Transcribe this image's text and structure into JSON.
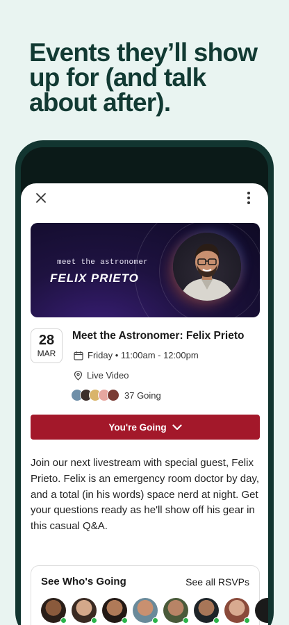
{
  "headline": "Events they’ll show up for (and talk about after).",
  "sheet": {
    "close_icon": "close-icon",
    "more_icon": "more-vertical-icon"
  },
  "banner": {
    "subtitle": "meet the astronomer",
    "title": "FELIX PRIETO"
  },
  "event": {
    "day": "28",
    "month": "MAR",
    "title": "Meet the Astronomer: Felix Prieto",
    "schedule": "Friday • 11:00am - 12:00pm",
    "location": "Live Video",
    "going_count": "37 Going",
    "rsvp_label": "You're Going",
    "description": "Join our next livestream with special guest, Felix Prieto. Felix is an emergency room doctor by day, and a total (in his words) space nerd at night. Get your questions ready as he'll show off his gear in this casual Q&A."
  },
  "who_going": {
    "title": "See Who's Going",
    "link": "See all RSVPs"
  },
  "colors": {
    "background": "#e9f4f1",
    "headline": "#123a33",
    "accent": "#a3182a",
    "online": "#2cb34a"
  }
}
